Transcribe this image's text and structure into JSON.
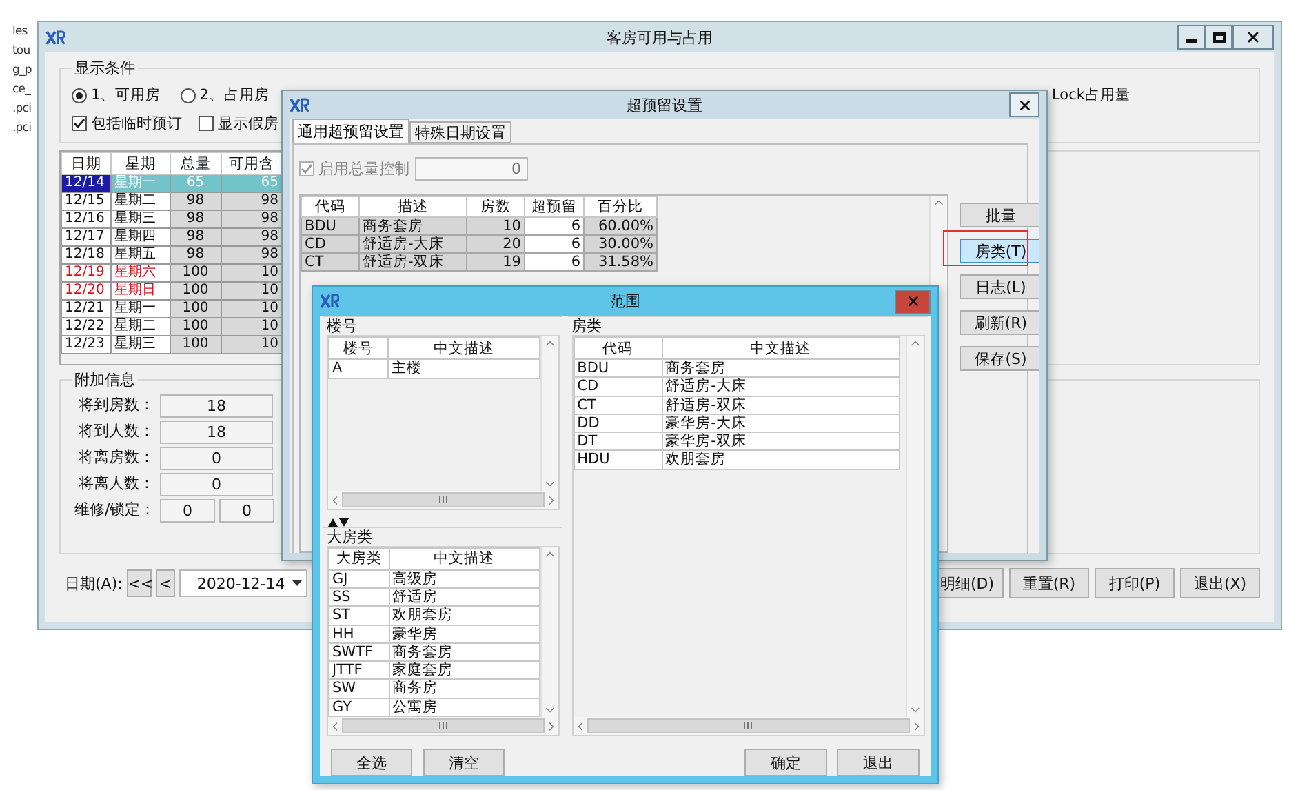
{
  "desktop_fragments": [
    "les",
    "tou",
    "g_p",
    "ce_",
    ".pci",
    ".pci"
  ],
  "main_window": {
    "title": "客房可用与占用",
    "display_conditions": {
      "legend": "显示条件",
      "radios": [
        {
          "label": "1、可用房",
          "selected": true
        },
        {
          "label": "2、占用房",
          "selected": false
        }
      ],
      "checkboxes": [
        {
          "label": "包括临时预订",
          "checked": true
        },
        {
          "label": "显示假房",
          "checked": false
        }
      ],
      "lock_label": "Lock占用量"
    },
    "availability_table": {
      "columns": [
        "日期",
        "星期",
        "总量",
        "可用含"
      ],
      "rows": [
        {
          "cells": [
            "12/14",
            "星期一",
            "65",
            "65"
          ],
          "selected": true,
          "weekend": false
        },
        {
          "cells": [
            "12/15",
            "星期二",
            "98",
            "98"
          ],
          "selected": false,
          "weekend": false
        },
        {
          "cells": [
            "12/16",
            "星期三",
            "98",
            "98"
          ],
          "selected": false,
          "weekend": false
        },
        {
          "cells": [
            "12/17",
            "星期四",
            "98",
            "98"
          ],
          "selected": false,
          "weekend": false
        },
        {
          "cells": [
            "12/18",
            "星期五",
            "98",
            "98"
          ],
          "selected": false,
          "weekend": false
        },
        {
          "cells": [
            "12/19",
            "星期六",
            "100",
            "10"
          ],
          "selected": false,
          "weekend": true
        },
        {
          "cells": [
            "12/20",
            "星期日",
            "100",
            "10"
          ],
          "selected": false,
          "weekend": true
        },
        {
          "cells": [
            "12/21",
            "星期一",
            "100",
            "10"
          ],
          "selected": false,
          "weekend": false
        },
        {
          "cells": [
            "12/22",
            "星期二",
            "100",
            "10"
          ],
          "selected": false,
          "weekend": false
        },
        {
          "cells": [
            "12/23",
            "星期三",
            "100",
            "10"
          ],
          "selected": false,
          "weekend": false
        }
      ]
    },
    "extra_info": {
      "legend": "附加信息",
      "fields": [
        {
          "label": "将到房数：",
          "values": [
            "18"
          ]
        },
        {
          "label": "将到人数：",
          "values": [
            "18"
          ]
        },
        {
          "label": "将离房数：",
          "values": [
            "0"
          ]
        },
        {
          "label": "将离人数：",
          "values": [
            "0"
          ]
        },
        {
          "label": "维修/锁定：",
          "values": [
            "0",
            "0"
          ]
        }
      ]
    },
    "date_nav": {
      "label": "日期(A):",
      "buttons": [
        "<<",
        "<"
      ],
      "value": "2020-12-14"
    },
    "buttons": [
      "明细(D)",
      "重置(R)",
      "打印(P)",
      "退出(X)"
    ]
  },
  "overbooking_dialog": {
    "title": "超预留设置",
    "tabs": [
      {
        "label": "通用超预留设置",
        "selected": true
      },
      {
        "label": "特殊日期设置",
        "selected": false
      }
    ],
    "total_control": {
      "label": "启用总量控制",
      "checked": true,
      "disabled": true,
      "value": "0"
    },
    "table": {
      "columns": [
        "代码",
        "描述",
        "房数",
        "超预留",
        "百分比"
      ],
      "rows": [
        [
          "BDU",
          "商务套房",
          "10",
          "6",
          "60.00%"
        ],
        [
          "CD",
          "舒适房-大床",
          "20",
          "6",
          "30.00%"
        ],
        [
          "CT",
          "舒适房-双床",
          "19",
          "6",
          "31.58%"
        ]
      ]
    },
    "buttons": [
      {
        "label": "批量",
        "highlighted": false,
        "annotated": false
      },
      {
        "label": "房类(T)",
        "highlighted": true,
        "annotated": true
      },
      {
        "label": "日志(L)",
        "highlighted": false,
        "annotated": false
      },
      {
        "label": "刷新(R)",
        "highlighted": false,
        "annotated": false
      },
      {
        "label": "保存(S)",
        "highlighted": false,
        "annotated": false
      }
    ]
  },
  "range_dialog": {
    "title": "范围",
    "building_group": {
      "legend": "楼号",
      "columns": [
        "楼号",
        "中文描述"
      ],
      "rows": [
        [
          "A",
          "主楼"
        ]
      ]
    },
    "category_group": {
      "legend": "大房类",
      "columns": [
        "大房类",
        "中文描述"
      ],
      "rows": [
        [
          "GJ",
          "高级房"
        ],
        [
          "SS",
          "舒适房"
        ],
        [
          "ST",
          "欢朋套房"
        ],
        [
          "HH",
          "豪华房"
        ],
        [
          "SWTF",
          "商务套房"
        ],
        [
          "JTTF",
          "家庭套房"
        ],
        [
          "SW",
          "商务房"
        ],
        [
          "GY",
          "公寓房"
        ]
      ]
    },
    "room_type_group": {
      "legend": "房类",
      "columns": [
        "代码",
        "中文描述"
      ],
      "rows": [
        [
          "BDU",
          "商务套房"
        ],
        [
          "CD",
          "舒适房-大床"
        ],
        [
          "CT",
          "舒适房-双床"
        ],
        [
          "DD",
          "豪华房-大床"
        ],
        [
          "DT",
          "豪华房-双床"
        ],
        [
          "HDU",
          "欢朋套房"
        ]
      ]
    },
    "left_buttons": [
      "全选",
      "清空"
    ],
    "right_buttons": [
      "确定",
      "退出"
    ]
  }
}
